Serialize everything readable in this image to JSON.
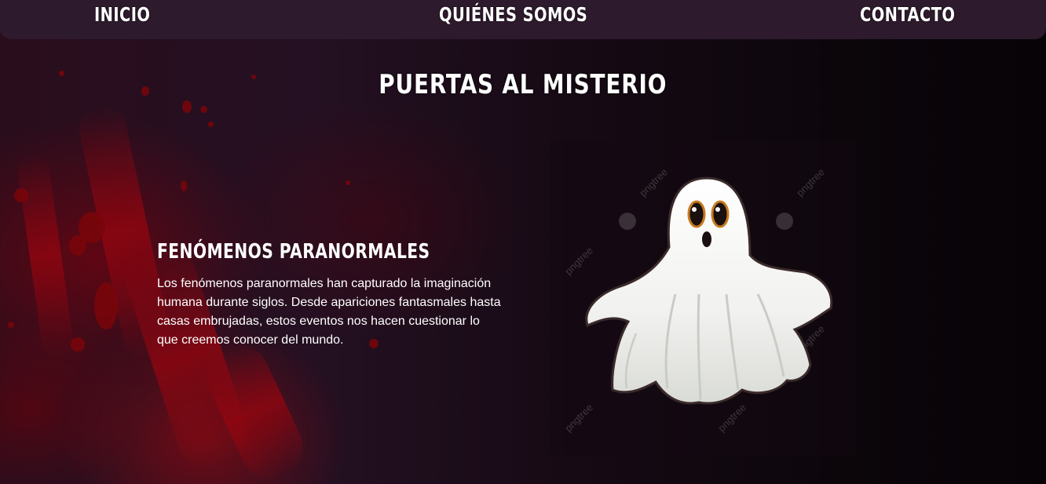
{
  "nav": {
    "items": [
      {
        "label": "INICIO"
      },
      {
        "label": "QUIÉNES SOMOS"
      },
      {
        "label": "CONTACTO"
      }
    ]
  },
  "hero": {
    "title": "PUERTAS AL MISTERIO"
  },
  "section": {
    "title": "FENÓMENOS PARANORMALES",
    "text": "Los fenómenos paranormales han capturado la imaginación humana durante siglos. Desde apariciones fantasmales hasta casas embrujadas, estos eventos nos hacen cuestionar lo que creemos conocer del mundo."
  },
  "image": {
    "icon": "ghost-illustration",
    "watermark": "pngtree"
  },
  "colors": {
    "nav_bg": "#2d1a2c",
    "blood": "#7a0509",
    "text": "#ffffff"
  }
}
